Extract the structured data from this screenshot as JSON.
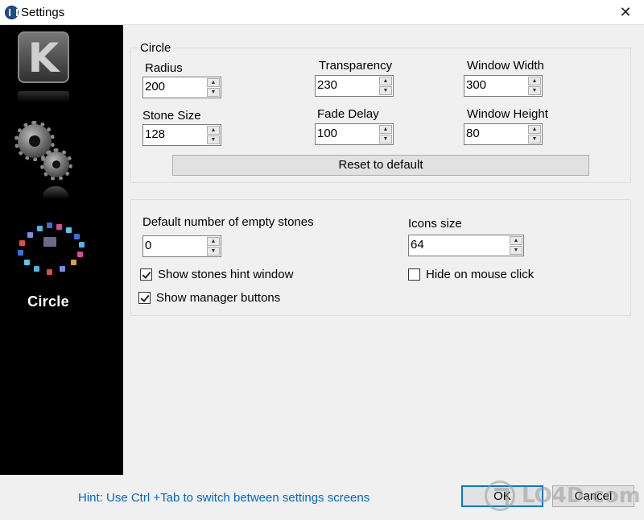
{
  "window": {
    "title": "Settings",
    "close_glyph": "✕"
  },
  "sidebar": {
    "items": [
      {
        "name": "k-logo",
        "glyph": "K"
      },
      {
        "name": "gears-icon"
      },
      {
        "name": "circle-icon",
        "label": "Circle",
        "selected": true
      }
    ]
  },
  "circle_group": {
    "title": "Circle",
    "radius": {
      "label": "Radius",
      "value": "200"
    },
    "transparency": {
      "label": "Transparency",
      "value": "230"
    },
    "window_width": {
      "label": "Window Width",
      "value": "300"
    },
    "stone_size": {
      "label": "Stone Size",
      "value": "128"
    },
    "fade_delay": {
      "label": "Fade Delay",
      "value": "100"
    },
    "window_height": {
      "label": "Window Height",
      "value": "80"
    },
    "reset_label": "Reset to default"
  },
  "stones_group": {
    "empty_stones": {
      "label": "Default number of empty stones",
      "value": "0"
    },
    "icons_size": {
      "label": "Icons size",
      "value": "64"
    },
    "show_hint": {
      "label": "Show stones hint window",
      "checked": true
    },
    "hide_on_click": {
      "label": "Hide on mouse click",
      "checked": false
    },
    "show_manager": {
      "label": "Show manager buttons",
      "checked": true
    }
  },
  "footer": {
    "hint": "Hint: Use Ctrl +Tab to switch between settings screens",
    "ok_label": "OK",
    "cancel_label": "Cancel"
  },
  "spinner_glyphs": {
    "up": "▲",
    "down": "▼"
  },
  "watermark": {
    "text": "LO4D.com"
  },
  "colors": {
    "hint": "#0066cc",
    "sidebar_bg": "#000000",
    "focus": "#0078d7"
  }
}
